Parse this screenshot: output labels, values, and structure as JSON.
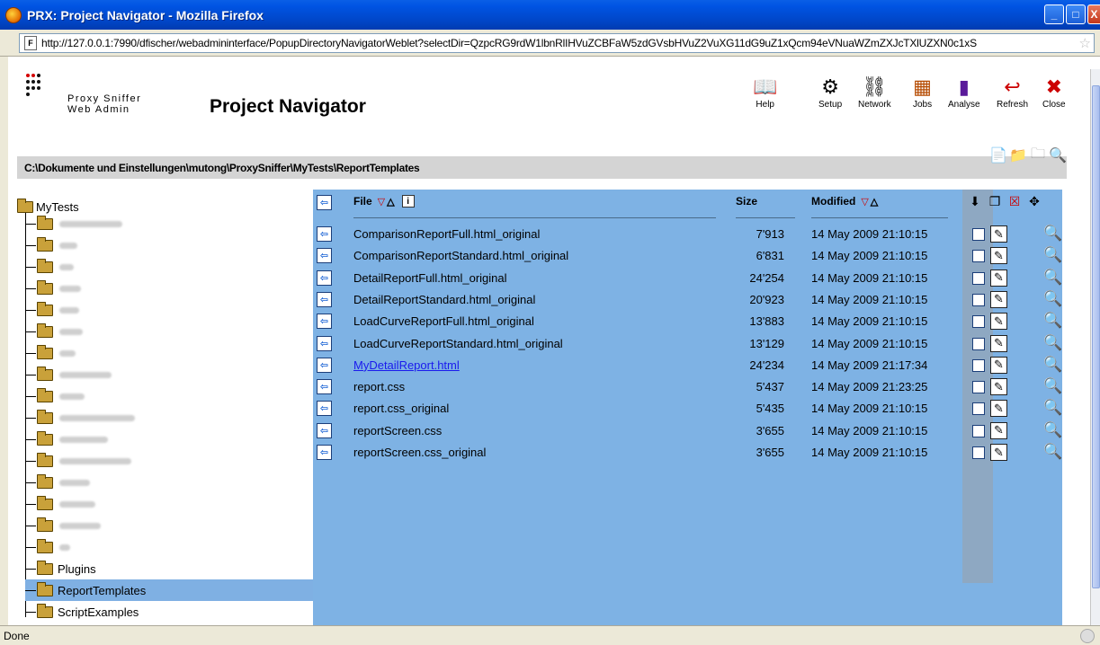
{
  "window": {
    "title": "PRX: Project Navigator - Mozilla Firefox",
    "buttons": {
      "minimize": "_",
      "maximize": "□",
      "close": "X"
    }
  },
  "urlbar": {
    "url": "http://127.0.0.1:7990/dfischer/webadmininterface/PopupDirectoryNavigatorWeblet?selectDir=QzpcRG9rdW1lbnRlIHVuZCBFaW5zdGVsbHVuZ2VuXG11dG9uZ1xQcm94eVNuaWZmZXJcTXlUZXN0c1xS"
  },
  "header": {
    "brand_line1": "Proxy Sniffer",
    "brand_line2": "Web Admin",
    "title": "Project Navigator",
    "tools": [
      {
        "label": "Help",
        "icon": "help-book-icon"
      },
      {
        "label": "Setup",
        "icon": "gear-icon"
      },
      {
        "label": "Network",
        "icon": "network-icon"
      },
      {
        "label": "Jobs",
        "icon": "jobs-icon"
      },
      {
        "label": "Analyse",
        "icon": "analyse-chart-icon"
      },
      {
        "label": "Refresh",
        "icon": "refresh-arrow-icon"
      },
      {
        "label": "Close",
        "icon": "close-x-icon"
      }
    ]
  },
  "path": "C:\\Dokumente und Einstellungen\\mutong\\ProxySniffer\\MyTests\\ReportTemplates",
  "tree": {
    "root": "MyTests",
    "items": [
      {
        "label": "",
        "blurred": true,
        "w": 70
      },
      {
        "label": "",
        "blurred": true,
        "w": 20
      },
      {
        "label": "",
        "blurred": true,
        "w": 16
      },
      {
        "label": "",
        "blurred": true,
        "w": 24
      },
      {
        "label": "",
        "blurred": true,
        "w": 22
      },
      {
        "label": "",
        "blurred": true,
        "w": 26
      },
      {
        "label": "",
        "blurred": true,
        "w": 18
      },
      {
        "label": "",
        "blurred": true,
        "w": 58
      },
      {
        "label": "",
        "blurred": true,
        "w": 28
      },
      {
        "label": "",
        "blurred": true,
        "w": 84
      },
      {
        "label": "",
        "blurred": true,
        "w": 54
      },
      {
        "label": "",
        "blurred": true,
        "w": 80
      },
      {
        "label": "",
        "blurred": true,
        "w": 34
      },
      {
        "label": "",
        "blurred": true,
        "w": 40
      },
      {
        "label": "",
        "blurred": true,
        "w": 46
      },
      {
        "label": "",
        "blurred": true,
        "w": 12
      },
      {
        "label": "Plugins",
        "blurred": false
      },
      {
        "label": "ReportTemplates",
        "blurred": false,
        "selected": true
      },
      {
        "label": "ScriptExamples",
        "blurred": false
      }
    ]
  },
  "table": {
    "headers": {
      "file": "File",
      "size": "Size",
      "modified": "Modified"
    },
    "rows": [
      {
        "name": "ComparisonReportFull.html_original",
        "size": "7'913",
        "modified": "14 May 2009 21:10:15"
      },
      {
        "name": "ComparisonReportStandard.html_original",
        "size": "6'831",
        "modified": "14 May 2009 21:10:15"
      },
      {
        "name": "DetailReportFull.html_original",
        "size": "24'254",
        "modified": "14 May 2009 21:10:15"
      },
      {
        "name": "DetailReportStandard.html_original",
        "size": "20'923",
        "modified": "14 May 2009 21:10:15"
      },
      {
        "name": "LoadCurveReportFull.html_original",
        "size": "13'883",
        "modified": "14 May 2009 21:10:15"
      },
      {
        "name": "LoadCurveReportStandard.html_original",
        "size": "13'129",
        "modified": "14 May 2009 21:10:15"
      },
      {
        "name": "MyDetailReport.html",
        "size": "24'234",
        "modified": "14 May 2009 21:17:34",
        "link": true
      },
      {
        "name": "report.css",
        "size": "5'437",
        "modified": "14 May 2009 21:23:25"
      },
      {
        "name": "report.css_original",
        "size": "5'435",
        "modified": "14 May 2009 21:10:15"
      },
      {
        "name": "reportScreen.css",
        "size": "3'655",
        "modified": "14 May 2009 21:10:15"
      },
      {
        "name": "reportScreen.css_original",
        "size": "3'655",
        "modified": "14 May 2009 21:10:15"
      }
    ]
  },
  "status": {
    "text": "Done"
  },
  "colors": {
    "titlebar": "#0054e3",
    "panel": "#7eb2e4",
    "selected": "#7fb0e3",
    "link": "#1a1aed"
  }
}
